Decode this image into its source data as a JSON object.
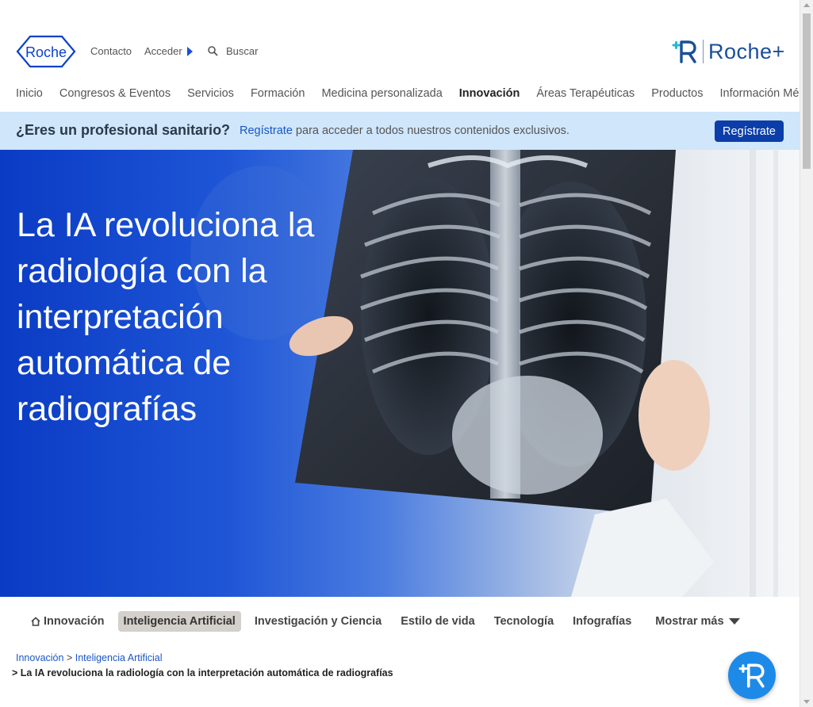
{
  "header": {
    "logo_text": "Roche",
    "contact": "Contacto",
    "login": "Acceder",
    "search": "Buscar",
    "roche_plus": "Roche+"
  },
  "nav": {
    "items": [
      {
        "label": "Inicio"
      },
      {
        "label": "Congresos & Eventos"
      },
      {
        "label": "Servicios"
      },
      {
        "label": "Formación"
      },
      {
        "label": "Medicina personalizada"
      },
      {
        "label": "Innovación",
        "active": true
      },
      {
        "label": "Áreas Terapéuticas"
      },
      {
        "label": "Productos"
      },
      {
        "label": "Información Médica"
      }
    ]
  },
  "banner": {
    "question": "¿Eres un profesional sanitario?",
    "link": "Regístrate",
    "text": " para acceder a todos nuestros contenidos exclusivos.",
    "button": "Regístrate"
  },
  "hero": {
    "title": "La IA revoluciona la radiología con la interpretación automática de radiografías"
  },
  "tabs": {
    "items": [
      {
        "label": "Innovación",
        "icon": "home-icon"
      },
      {
        "label": "Inteligencia Artificial",
        "active": true
      },
      {
        "label": "Investigación y Ciencia"
      },
      {
        "label": "Estilo de vida"
      },
      {
        "label": "Tecnología"
      },
      {
        "label": "Infografías"
      }
    ],
    "more": "Mostrar más"
  },
  "breadcrumb": {
    "items": [
      "Innovación",
      "Inteligencia Artificial"
    ],
    "separator": ">",
    "current": "La IA revoluciona la radiología con la interpretación automática de radiografías"
  },
  "colors": {
    "brand_blue": "#0b3ea8",
    "banner_bg": "#cfe6fb",
    "link": "#1a56c4",
    "roche_plus": "#1a4e99",
    "fab": "#1e8ae8"
  }
}
